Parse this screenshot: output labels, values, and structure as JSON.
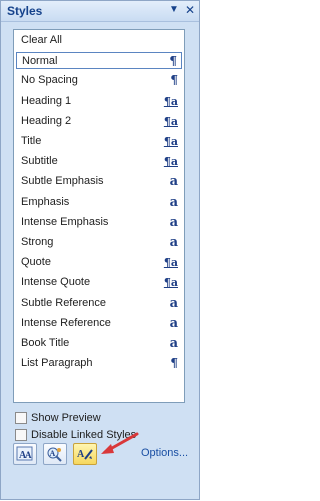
{
  "panel": {
    "title": "Styles",
    "dropdown_icon": "chevron-down-icon",
    "close_icon": "close-icon"
  },
  "styles": [
    {
      "name": "Clear All",
      "glyph": ""
    },
    {
      "name": "Normal",
      "glyph": "¶",
      "selected": true
    },
    {
      "name": "No Spacing",
      "glyph": "¶"
    },
    {
      "name": "Heading 1",
      "glyph": "¶a"
    },
    {
      "name": "Heading 2",
      "glyph": "¶a"
    },
    {
      "name": "Title",
      "glyph": "¶a"
    },
    {
      "name": "Subtitle",
      "glyph": "¶a"
    },
    {
      "name": "Subtle Emphasis",
      "glyph": "a"
    },
    {
      "name": "Emphasis",
      "glyph": "a"
    },
    {
      "name": "Intense Emphasis",
      "glyph": "a"
    },
    {
      "name": "Strong",
      "glyph": "a"
    },
    {
      "name": "Quote",
      "glyph": "¶a"
    },
    {
      "name": "Intense Quote",
      "glyph": "¶a"
    },
    {
      "name": "Subtle Reference",
      "glyph": "a"
    },
    {
      "name": "Intense Reference",
      "glyph": "a"
    },
    {
      "name": "Book Title",
      "glyph": "a"
    },
    {
      "name": "List Paragraph",
      "glyph": "¶"
    }
  ],
  "options": {
    "show_preview": {
      "label": "Show Preview",
      "checked": false
    },
    "disable_linked": {
      "label": "Disable Linked Styles",
      "checked": false
    }
  },
  "toolbar": {
    "new_style_icon": "new-style-icon",
    "style_inspector_icon": "style-inspector-icon",
    "manage_styles_icon": "manage-styles-icon",
    "options_link": "Options..."
  },
  "colors": {
    "pane_bg": "#cfe0f3",
    "accent": "#15428b",
    "arrow": "#d9383a",
    "highlight_button": "#f6d75e"
  }
}
